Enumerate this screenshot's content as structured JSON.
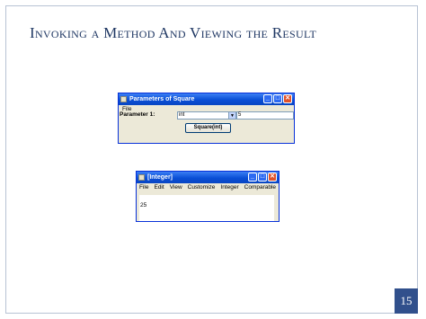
{
  "slide": {
    "title": "Invoking a Method And Viewing the Result",
    "page_number": "15"
  },
  "params_window": {
    "title": "Parameters of Square",
    "menu": [
      "File"
    ],
    "param_label": "Parameter 1:",
    "param_type": "int",
    "param_value": "5",
    "invoke_button": "Square(int)"
  },
  "result_window": {
    "title": "[Integer]",
    "menu": [
      "File",
      "Edit",
      "View",
      "Customize",
      "Integer",
      "Comparable"
    ],
    "value": "25"
  },
  "colors": {
    "title_text": "#1f3763",
    "badge": "#31508c",
    "xp_titlebar": "#0a4fd6"
  }
}
